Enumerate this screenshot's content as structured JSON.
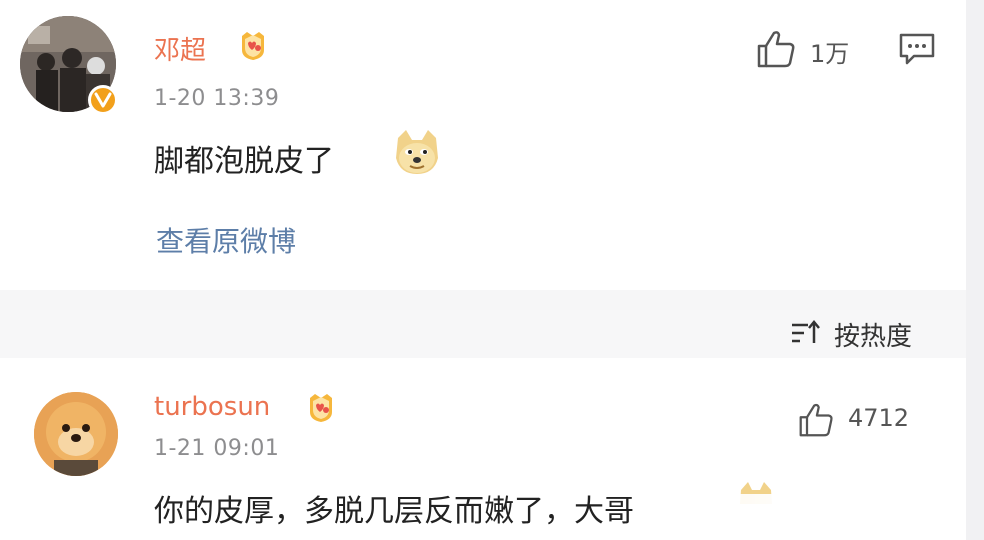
{
  "comments": [
    {
      "username": "邓超",
      "timestamp": "1-20 13:39",
      "text": "脚都泡脱皮了",
      "likes": "1万",
      "emoji": "doge-emoji",
      "verified": true
    },
    {
      "username": "turbosun",
      "timestamp": "1-21 09:01",
      "text": "你的皮厚，多脱几层反而嫩了，大哥",
      "likes": "4712",
      "emoji": "doge-emoji"
    }
  ],
  "view_original_label": "查看原微博",
  "sort": {
    "label": "按热度",
    "icon": "sort-icon"
  },
  "colors": {
    "username": "#eb7350",
    "link": "#5d7ea8",
    "verified_badge": "#f2a01b",
    "text": "#222222",
    "meta": "#8d8d8f"
  },
  "icons": [
    "like-icon",
    "reply-icon",
    "fan-badge-icon",
    "verified-badge-icon"
  ]
}
